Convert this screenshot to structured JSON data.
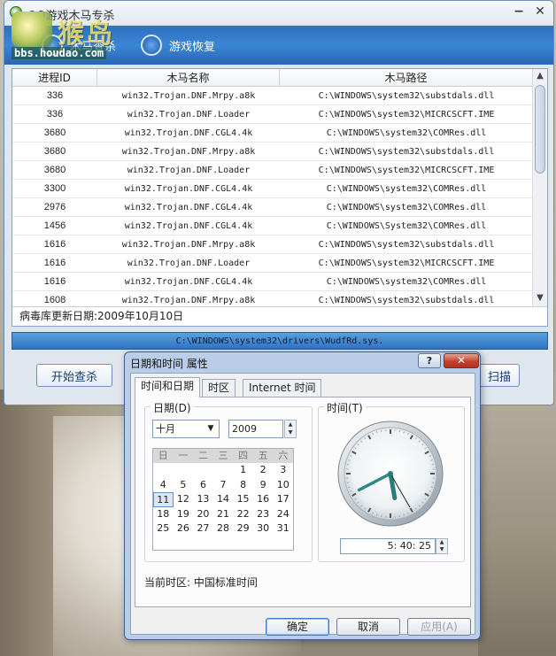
{
  "app": {
    "title": "QQ游戏木马专杀",
    "toolbar": [
      {
        "label": "木马查杀"
      },
      {
        "label": "游戏恢复"
      }
    ],
    "watermark": {
      "text": "猴岛",
      "url": "bbs.houdao.com"
    },
    "columns": [
      "进程ID",
      "木马名称",
      "木马路径"
    ],
    "rows": [
      {
        "pid": "336",
        "name": "win32.Trojan.DNF.Mrpy.a8k",
        "path": "C:\\WINDOWS\\system32\\substdals.dll"
      },
      {
        "pid": "336",
        "name": "win32.Trojan.DNF.Loader",
        "path": "C:\\WINDOWS\\system32\\MICRCSCFT.IME"
      },
      {
        "pid": "3680",
        "name": "win32.Trojan.DNF.CGL4.4k",
        "path": "C:\\WINDOWS\\system32\\COMRes.dll"
      },
      {
        "pid": "3680",
        "name": "win32.Trojan.DNF.Mrpy.a8k",
        "path": "C:\\WINDOWS\\system32\\substdals.dll"
      },
      {
        "pid": "3680",
        "name": "win32.Trojan.DNF.Loader",
        "path": "C:\\WINDOWS\\system32\\MICRCSCFT.IME"
      },
      {
        "pid": "3300",
        "name": "win32.Trojan.DNF.CGL4.4k",
        "path": "C:\\WINDOWS\\system32\\COMRes.dll"
      },
      {
        "pid": "2976",
        "name": "win32.Trojan.DNF.CGL4.4k",
        "path": "C:\\WINDOWS\\system32\\COMRes.dll"
      },
      {
        "pid": "1456",
        "name": "win32.Trojan.DNF.CGL4.4k",
        "path": "C:\\WINDOWS\\System32\\COMRes.dll"
      },
      {
        "pid": "1616",
        "name": "win32.Trojan.DNF.Mrpy.a8k",
        "path": "C:\\WINDOWS\\system32\\substdals.dll"
      },
      {
        "pid": "1616",
        "name": "win32.Trojan.DNF.Loader",
        "path": "C:\\WINDOWS\\system32\\MICRCSCFT.IME"
      },
      {
        "pid": "1616",
        "name": "win32.Trojan.DNF.CGL4.4k",
        "path": "C:\\WINDOWS\\system32\\COMRes.dll"
      },
      {
        "pid": "1608",
        "name": "win32.Trojan.DNF.Mrpy.a8k",
        "path": "C:\\WINDOWS\\system32\\substdals.dll"
      }
    ],
    "db_update": "病毒库更新日期:2009年10月10日",
    "current_path": "C:\\WINDOWS\\system32\\drivers\\WudfRd.sys.",
    "btn_start": "开始查杀",
    "btn_scan_partial": "扫描"
  },
  "dialog": {
    "title": "日期和时间 属性",
    "help": "?",
    "close": "✕",
    "tabs": [
      "时间和日期",
      "时区",
      "Internet 时间"
    ],
    "date_group": "日期(D)",
    "month": "十月",
    "year": "2009",
    "weekdays": [
      "日",
      "一",
      "二",
      "三",
      "四",
      "五",
      "六"
    ],
    "weeks": [
      [
        "",
        "",
        "",
        "",
        "1",
        "2",
        "3"
      ],
      [
        "4",
        "5",
        "6",
        "7",
        "8",
        "9",
        "10"
      ],
      [
        "11",
        "12",
        "13",
        "14",
        "15",
        "16",
        "17"
      ],
      [
        "18",
        "19",
        "20",
        "21",
        "22",
        "23",
        "24"
      ],
      [
        "25",
        "26",
        "27",
        "28",
        "29",
        "30",
        "31"
      ],
      [
        "",
        "",
        "",
        "",
        "",
        "",
        ""
      ]
    ],
    "selected_day": "11",
    "time_group": "时间(T)",
    "time": "5: 40: 25",
    "clock": {
      "hour": 5,
      "minute": 40,
      "second": 25
    },
    "timezone_label": "当前时区: 中国标准时间",
    "ok": "确定",
    "cancel": "取消",
    "apply": "应用(A)"
  }
}
